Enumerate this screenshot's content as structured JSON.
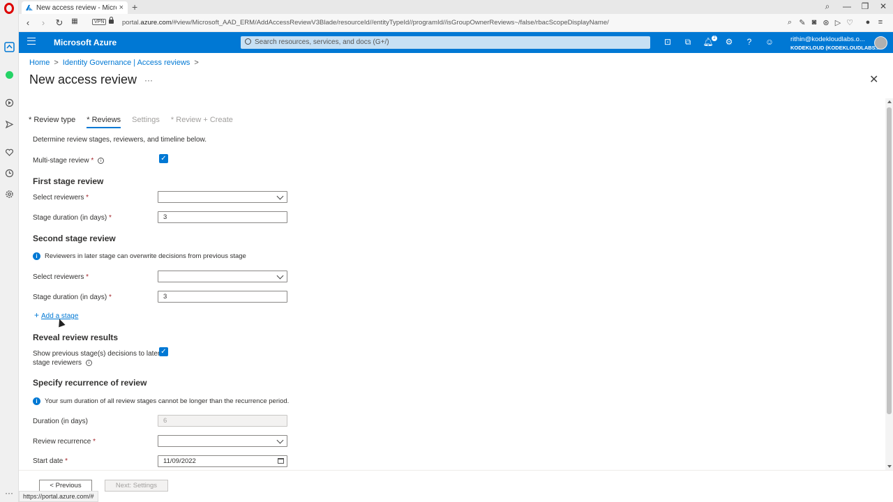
{
  "browser": {
    "tab_title": "New access review - Micro",
    "tab_close": "×",
    "new_tab": "+",
    "url_prefix": "portal.",
    "url_domain": "azure.com",
    "url_rest": "/#view/Microsoft_AAD_ERM/AddAccessReviewV3Blade/resourceId//entityTypeId//programId//isGroupOwnerReviews~/false/rbacScopeDisplayName/",
    "vpn_label": "VPN",
    "status_url": "https://portal.azure.com/#"
  },
  "header": {
    "brand": "Microsoft Azure",
    "search_placeholder": "Search resources, services, and docs (G+/)",
    "notification_count": "2",
    "user_email": "rithin@kodekloudlabs.o...",
    "user_org": "KODEKLOUD (KODEKLOUDLABS...",
    "accent": "#0078d4"
  },
  "breadcrumb": {
    "home": "Home",
    "sep": ">",
    "identity_governance": "Identity Governance | Access reviews"
  },
  "page": {
    "title": "New access review",
    "ellipsis": "···",
    "close": "✕"
  },
  "tabs": [
    {
      "label": "* Review type",
      "state": "normal"
    },
    {
      "label": "* Reviews",
      "state": "active"
    },
    {
      "label": "Settings",
      "state": "disabled"
    },
    {
      "label": "* Review + Create",
      "state": "disabled"
    }
  ],
  "form": {
    "description": "Determine review stages, reviewers, and timeline below.",
    "multi_stage_label": "Multi-stage review",
    "multi_stage_checked": true,
    "required_mark": "*",
    "first_stage_heading": "First stage review",
    "select_reviewers_label": "Select reviewers",
    "stage_duration_label": "Stage duration (in days)",
    "first_stage_duration": "3",
    "second_stage_heading": "Second stage review",
    "second_stage_info": "Reviewers in later stage can overwrite decisions from previous stage",
    "second_stage_duration": "3",
    "add_stage": "Add a stage",
    "reveal_heading": "Reveal review results",
    "reveal_label_line1": "Show previous stage(s) decisions to later",
    "reveal_label_line2": "stage reviewers",
    "reveal_checked": true,
    "recurrence_heading": "Specify recurrence of review",
    "recurrence_info": "Your sum duration of all review stages cannot be longer than the recurrence period.",
    "duration_label": "Duration (in days)",
    "duration_value": "6",
    "recurrence_label": "Review recurrence",
    "start_date_label": "Start date",
    "start_date_value": "11/09/2022"
  },
  "footer": {
    "previous": "< Previous",
    "next": "Next: Settings"
  }
}
